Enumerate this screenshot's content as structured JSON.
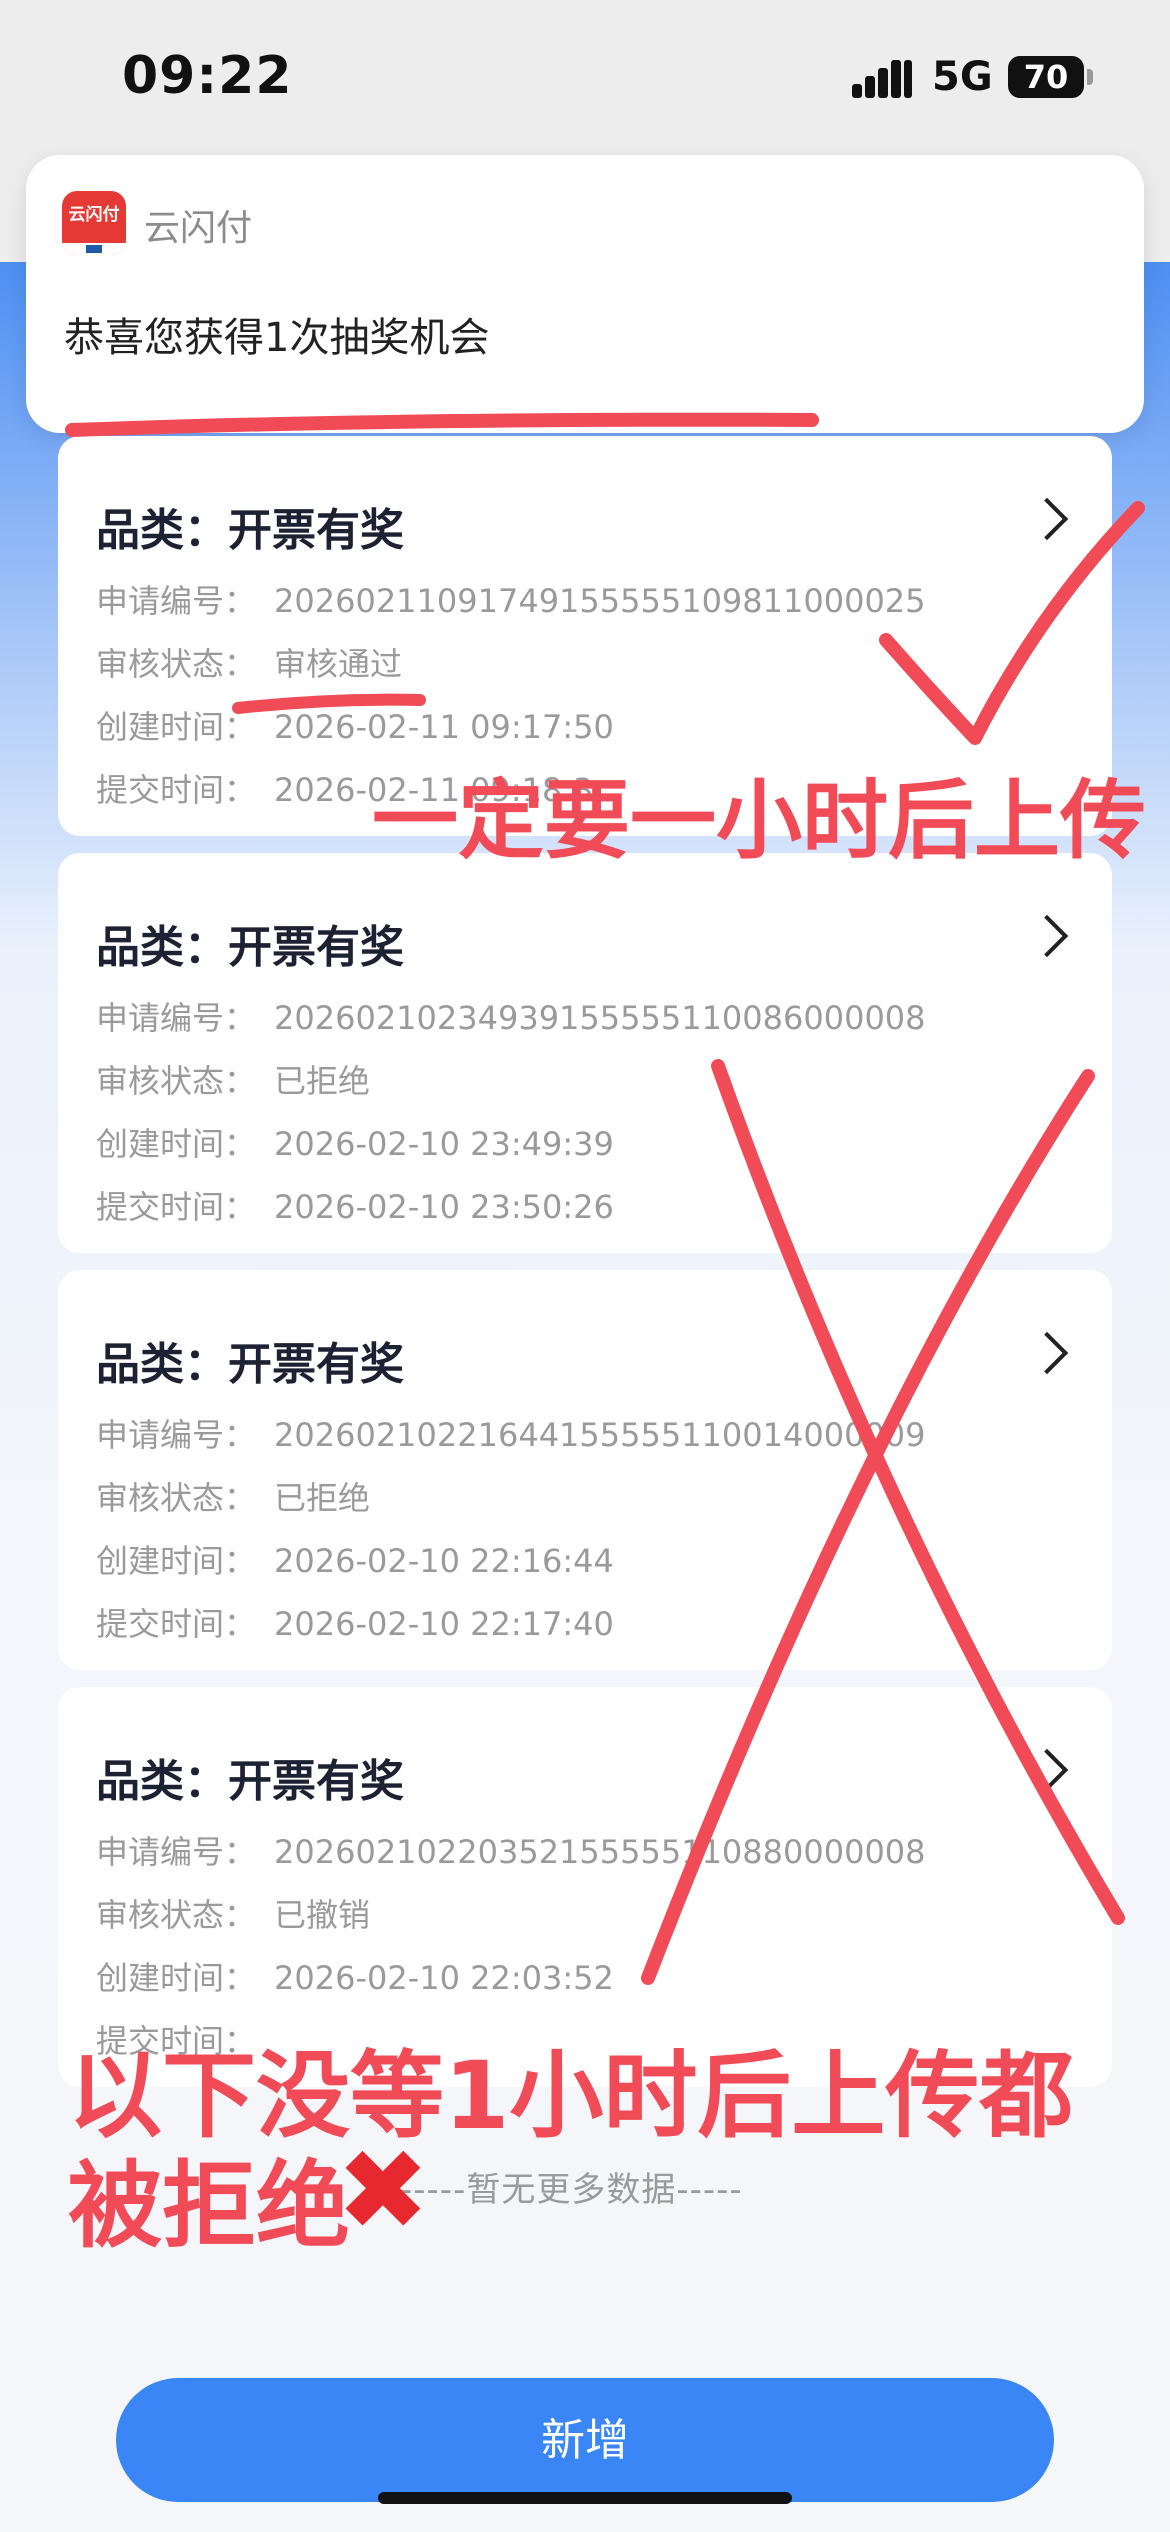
{
  "status_bar": {
    "time": "09:22",
    "network": "5G",
    "battery": "70"
  },
  "notification": {
    "app_name": "云闪付",
    "app_icon_text": "云闪付",
    "message": "恭喜您获得1次抽奖机会"
  },
  "labels": {
    "category": "品类：",
    "app_no": "申请编号：",
    "review": "审核状态：",
    "created": "创建时间：",
    "submitted": "提交时间："
  },
  "records": [
    {
      "category": "开票有奖",
      "app_no": "2026021109174915555510981100002​5",
      "review_status": "审核通过",
      "created": "2026-02-11 09:17:50",
      "submitted": "2026-02-11 09:18:3"
    },
    {
      "category": "开票有奖",
      "app_no": "20260210234939155555110086000008",
      "review_status": "已拒绝",
      "created": "2026-02-10 23:49:39",
      "submitted": "2026-02-10 23:50:26"
    },
    {
      "category": "开票有奖",
      "app_no": "20260210221644155555110014000009",
      "review_status": "已拒绝",
      "created": "2026-02-10 22:16:44",
      "submitted": "2026-02-10 22:17:40"
    },
    {
      "category": "开票有奖",
      "app_no": "20260210220352155555110880000008",
      "review_status": "已撤销",
      "created": "2026-02-10 22:03:52",
      "submitted": ""
    }
  ],
  "no_more": "-----暂无更多数据-----",
  "add_button": "新增",
  "annotations": {
    "note_one_hour": "一定要一小时后上传",
    "note_rejected_line1": "以下没等1小时后上传都",
    "note_rejected_line2": "被拒绝"
  },
  "colors": {
    "accent": "#3a86f7",
    "annotation": "#f24b58"
  }
}
